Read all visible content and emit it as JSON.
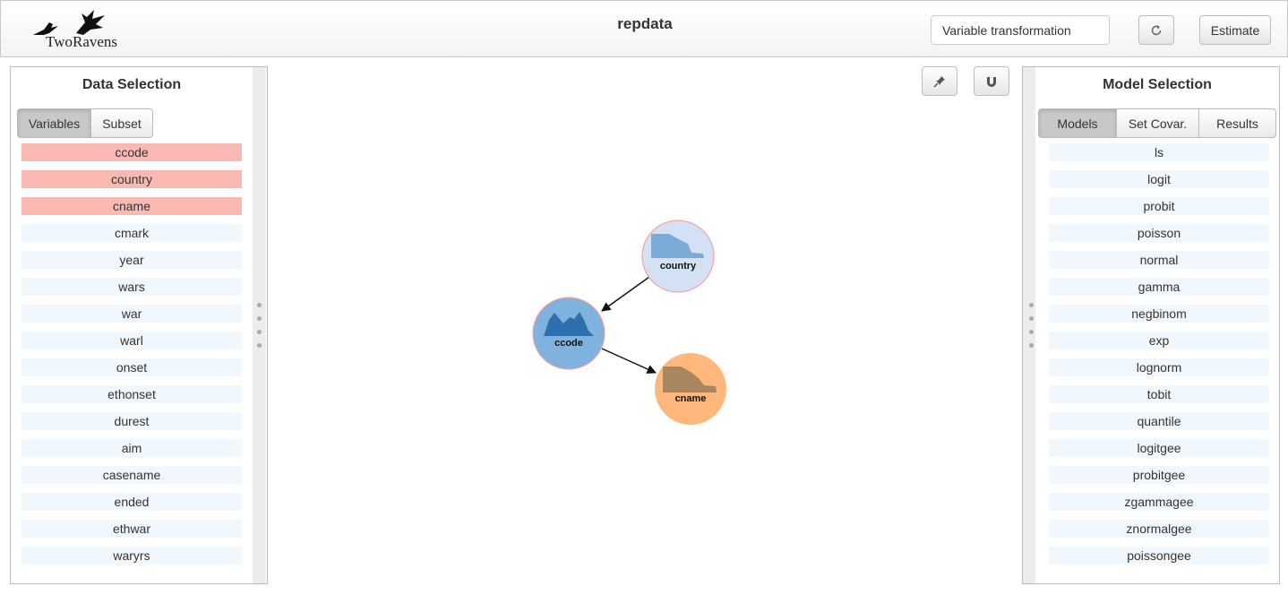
{
  "header": {
    "logo_text": "TwoRavens",
    "title": "repdata",
    "transform_placeholder": "Variable transformation",
    "estimate_label": "Estimate",
    "refresh_icon": "refresh-icon"
  },
  "left_panel": {
    "title": "Data Selection",
    "tabs": [
      {
        "label": "Variables",
        "active": true
      },
      {
        "label": "Subset",
        "active": false
      }
    ],
    "variables": [
      {
        "label": "ccode",
        "selected": true
      },
      {
        "label": "country",
        "selected": true
      },
      {
        "label": "cname",
        "selected": true
      },
      {
        "label": "cmark",
        "selected": false
      },
      {
        "label": "year",
        "selected": false
      },
      {
        "label": "wars",
        "selected": false
      },
      {
        "label": "war",
        "selected": false
      },
      {
        "label": "warl",
        "selected": false
      },
      {
        "label": "onset",
        "selected": false
      },
      {
        "label": "ethonset",
        "selected": false
      },
      {
        "label": "durest",
        "selected": false
      },
      {
        "label": "aim",
        "selected": false
      },
      {
        "label": "casename",
        "selected": false
      },
      {
        "label": "ended",
        "selected": false
      },
      {
        "label": "ethwar",
        "selected": false
      },
      {
        "label": "waryrs",
        "selected": false
      }
    ]
  },
  "right_panel": {
    "title": "Model Selection",
    "tabs": [
      {
        "label": "Models",
        "active": true
      },
      {
        "label": "Set Covar.",
        "active": false
      },
      {
        "label": "Results",
        "active": false
      }
    ],
    "models": [
      "ls",
      "logit",
      "probit",
      "poisson",
      "normal",
      "gamma",
      "negbinom",
      "exp",
      "lognorm",
      "tobit",
      "quantile",
      "logitgee",
      "probitgee",
      "zgammagee",
      "znormalgee",
      "poissongee"
    ]
  },
  "canvas": {
    "pin_icon": "pin-icon",
    "magnet_icon": "magnet-icon",
    "nodes": [
      {
        "id": "country",
        "label": "country",
        "color": "#d4e0f4",
        "plot_color": "#7aaad6"
      },
      {
        "id": "ccode",
        "label": "ccode",
        "color": "#7fb2dc",
        "plot_color": "#2e6fae"
      },
      {
        "id": "cname",
        "label": "cname",
        "color": "#ffb77c",
        "plot_color": "#a8865f"
      }
    ],
    "edges": [
      {
        "from": "country",
        "to": "ccode"
      },
      {
        "from": "ccode",
        "to": "cname"
      }
    ]
  },
  "colors": {
    "selected_variable": "#f9b9b2",
    "unselected_variable": "#f0f7fd"
  }
}
